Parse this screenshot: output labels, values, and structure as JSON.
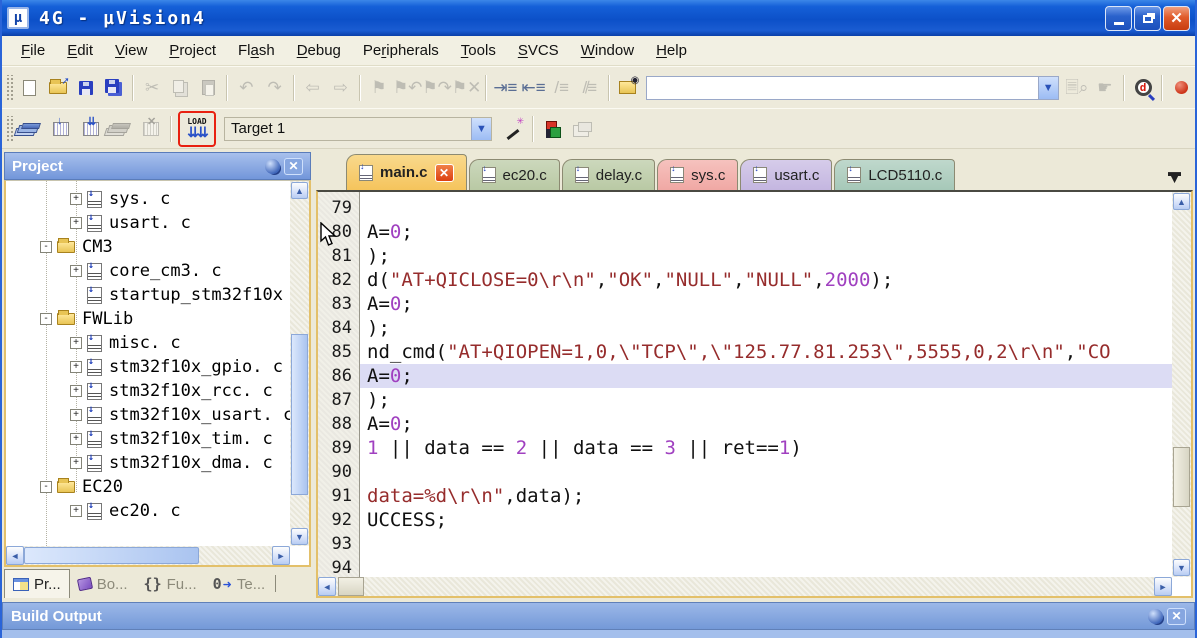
{
  "titlebar": {
    "title": "4G  -  µVision4",
    "app_icon": "uvision-logo",
    "buttons": {
      "minimize": "minimize",
      "restore": "restore",
      "close": "close"
    }
  },
  "menu": {
    "items": [
      {
        "label": "File",
        "u": 0
      },
      {
        "label": "Edit",
        "u": 0
      },
      {
        "label": "View",
        "u": 0
      },
      {
        "label": "Project",
        "u": 0
      },
      {
        "label": "Flash",
        "u": 2
      },
      {
        "label": "Debug",
        "u": 0
      },
      {
        "label": "Peripherals",
        "u": 2
      },
      {
        "label": "Tools",
        "u": 0
      },
      {
        "label": "SVCS",
        "u": 0
      },
      {
        "label": "Window",
        "u": 0
      },
      {
        "label": "Help",
        "u": 0
      }
    ]
  },
  "toolbar_main": {
    "search_value": "",
    "icon_names": [
      "new-file",
      "open-file",
      "save",
      "save-all",
      "cut",
      "copy",
      "paste",
      "undo",
      "redo",
      "navigate-back",
      "navigate-forward",
      "bookmark-toggle",
      "bookmark-prev",
      "bookmark-next",
      "bookmark-clear",
      "indent-right",
      "indent-left",
      "comment",
      "uncomment",
      "find-in-files",
      "search-combo",
      "find-in-doc",
      "run-to-cursor",
      "debug-session",
      "breakpoint"
    ]
  },
  "toolbar_build": {
    "load_label": "LOAD",
    "target_value": "Target 1",
    "icon_names": [
      "translate",
      "build",
      "rebuild",
      "batch-build",
      "stop-build",
      "load-download",
      "target-select",
      "options-wizard",
      "configure-flash",
      "window-layout"
    ],
    "load_annotation_color": "#e82010"
  },
  "project_panel": {
    "title": "Project",
    "tree": [
      {
        "label": "sys. c",
        "level": 2,
        "toggle": "+",
        "icon": "file"
      },
      {
        "label": "usart. c",
        "level": 2,
        "toggle": "+",
        "icon": "file"
      },
      {
        "label": "CM3",
        "level": 1,
        "toggle": "-",
        "icon": "folder"
      },
      {
        "label": "core_cm3. c",
        "level": 2,
        "toggle": "+",
        "icon": "file"
      },
      {
        "label": "startup_stm32f10x",
        "level": 2,
        "toggle": "",
        "icon": "file"
      },
      {
        "label": "FWLib",
        "level": 1,
        "toggle": "-",
        "icon": "folder"
      },
      {
        "label": "misc. c",
        "level": 2,
        "toggle": "+",
        "icon": "file"
      },
      {
        "label": "stm32f10x_gpio. c",
        "level": 2,
        "toggle": "+",
        "icon": "file"
      },
      {
        "label": "stm32f10x_rcc. c",
        "level": 2,
        "toggle": "+",
        "icon": "file"
      },
      {
        "label": "stm32f10x_usart. c",
        "level": 2,
        "toggle": "+",
        "icon": "file"
      },
      {
        "label": "stm32f10x_tim. c",
        "level": 2,
        "toggle": "+",
        "icon": "file"
      },
      {
        "label": "stm32f10x_dma. c",
        "level": 2,
        "toggle": "+",
        "icon": "file"
      },
      {
        "label": "EC20",
        "level": 1,
        "toggle": "-",
        "icon": "folder"
      },
      {
        "label": "ec20. c",
        "level": 2,
        "toggle": "+",
        "icon": "file"
      }
    ],
    "bottom_tabs": [
      {
        "label": "Pr...",
        "active": true,
        "icon": "project-tab-icon"
      },
      {
        "label": "Bo...",
        "active": false,
        "icon": "books-tab-icon"
      },
      {
        "label": "Fu...",
        "active": false,
        "icon": "functions-tab-icon"
      },
      {
        "label": "Te...",
        "active": false,
        "icon": "templates-tab-icon"
      }
    ]
  },
  "editor": {
    "tabs": [
      {
        "label": "main.c",
        "color": "#f5c45c",
        "color2": "#f9d98c",
        "active": true,
        "closable": true
      },
      {
        "label": "ec20.c",
        "color": "#b9c9a4",
        "color2": "#ccd8bc",
        "active": false,
        "closable": false
      },
      {
        "label": "delay.c",
        "color": "#b9c9a4",
        "color2": "#ccd8bc",
        "active": false,
        "closable": false
      },
      {
        "label": "sys.c",
        "color": "#f0a8a4",
        "color2": "#f6c2be",
        "active": false,
        "closable": false
      },
      {
        "label": "usart.c",
        "color": "#c4b6e0",
        "color2": "#d6ccea",
        "active": false,
        "closable": false
      },
      {
        "label": "LCD5110.c",
        "color": "#a6c8b8",
        "color2": "#bfd8cc",
        "active": false,
        "closable": false
      }
    ],
    "current_line": 86,
    "lines": [
      {
        "n": 79,
        "segs": []
      },
      {
        "n": 80,
        "segs": [
          {
            "t": "A=",
            "c": "k"
          },
          {
            "t": "0",
            "c": "n"
          },
          {
            "t": ";",
            "c": "k"
          }
        ]
      },
      {
        "n": 81,
        "segs": [
          {
            "t": ");",
            "c": "k"
          }
        ]
      },
      {
        "n": 82,
        "segs": [
          {
            "t": "d(",
            "c": "k"
          },
          {
            "t": "\"AT+QICLOSE=0\\r\\n\"",
            "c": "s"
          },
          {
            "t": ",",
            "c": "k"
          },
          {
            "t": "\"OK\"",
            "c": "s"
          },
          {
            "t": ",",
            "c": "k"
          },
          {
            "t": "\"NULL\"",
            "c": "s"
          },
          {
            "t": ",",
            "c": "k"
          },
          {
            "t": "\"NULL\"",
            "c": "s"
          },
          {
            "t": ",",
            "c": "k"
          },
          {
            "t": "2000",
            "c": "n"
          },
          {
            "t": ");",
            "c": "k"
          }
        ]
      },
      {
        "n": 83,
        "segs": [
          {
            "t": "A=",
            "c": "k"
          },
          {
            "t": "0",
            "c": "n"
          },
          {
            "t": ";",
            "c": "k"
          }
        ]
      },
      {
        "n": 84,
        "segs": [
          {
            "t": ");",
            "c": "k"
          }
        ]
      },
      {
        "n": 85,
        "segs": [
          {
            "t": "nd_cmd(",
            "c": "k"
          },
          {
            "t": "\"AT+QIOPEN=1,0,\\\"TCP\\\",\\\"125.77.81.253\\\",5555,0,2\\r\\n\"",
            "c": "s"
          },
          {
            "t": ",",
            "c": "k"
          },
          {
            "t": "\"CO",
            "c": "s"
          }
        ]
      },
      {
        "n": 86,
        "segs": [
          {
            "t": "A=",
            "c": "k"
          },
          {
            "t": "0",
            "c": "n"
          },
          {
            "t": ";",
            "c": "k"
          }
        ]
      },
      {
        "n": 87,
        "segs": [
          {
            "t": ");",
            "c": "k"
          }
        ]
      },
      {
        "n": 88,
        "segs": [
          {
            "t": "A=",
            "c": "k"
          },
          {
            "t": "0",
            "c": "n"
          },
          {
            "t": ";",
            "c": "k"
          }
        ]
      },
      {
        "n": 89,
        "segs": [
          {
            "t": "1",
            "c": "n"
          },
          {
            "t": " || data == ",
            "c": "k"
          },
          {
            "t": "2",
            "c": "n"
          },
          {
            "t": " || data == ",
            "c": "k"
          },
          {
            "t": "3",
            "c": "n"
          },
          {
            "t": " || ret==",
            "c": "k"
          },
          {
            "t": "1",
            "c": "n"
          },
          {
            "t": ")",
            "c": "k"
          }
        ]
      },
      {
        "n": 90,
        "segs": []
      },
      {
        "n": 91,
        "segs": [
          {
            "t": "data=%d\\r\\n\"",
            "c": "s"
          },
          {
            "t": ",data);",
            "c": "k"
          }
        ]
      },
      {
        "n": 92,
        "segs": [
          {
            "t": "UCCESS;",
            "c": "k"
          }
        ]
      },
      {
        "n": 93,
        "segs": []
      },
      {
        "n": 94,
        "segs": []
      }
    ]
  },
  "build_output": {
    "title": "Build Output"
  },
  "colors": {
    "titlebar_blue": "#0c50c8",
    "string": "#962c2c",
    "number": "#a040c0",
    "current_line_highlight": "#dcdcf4",
    "panel_frame_gold": "#e3c06a",
    "annotation_red": "#e82010"
  }
}
